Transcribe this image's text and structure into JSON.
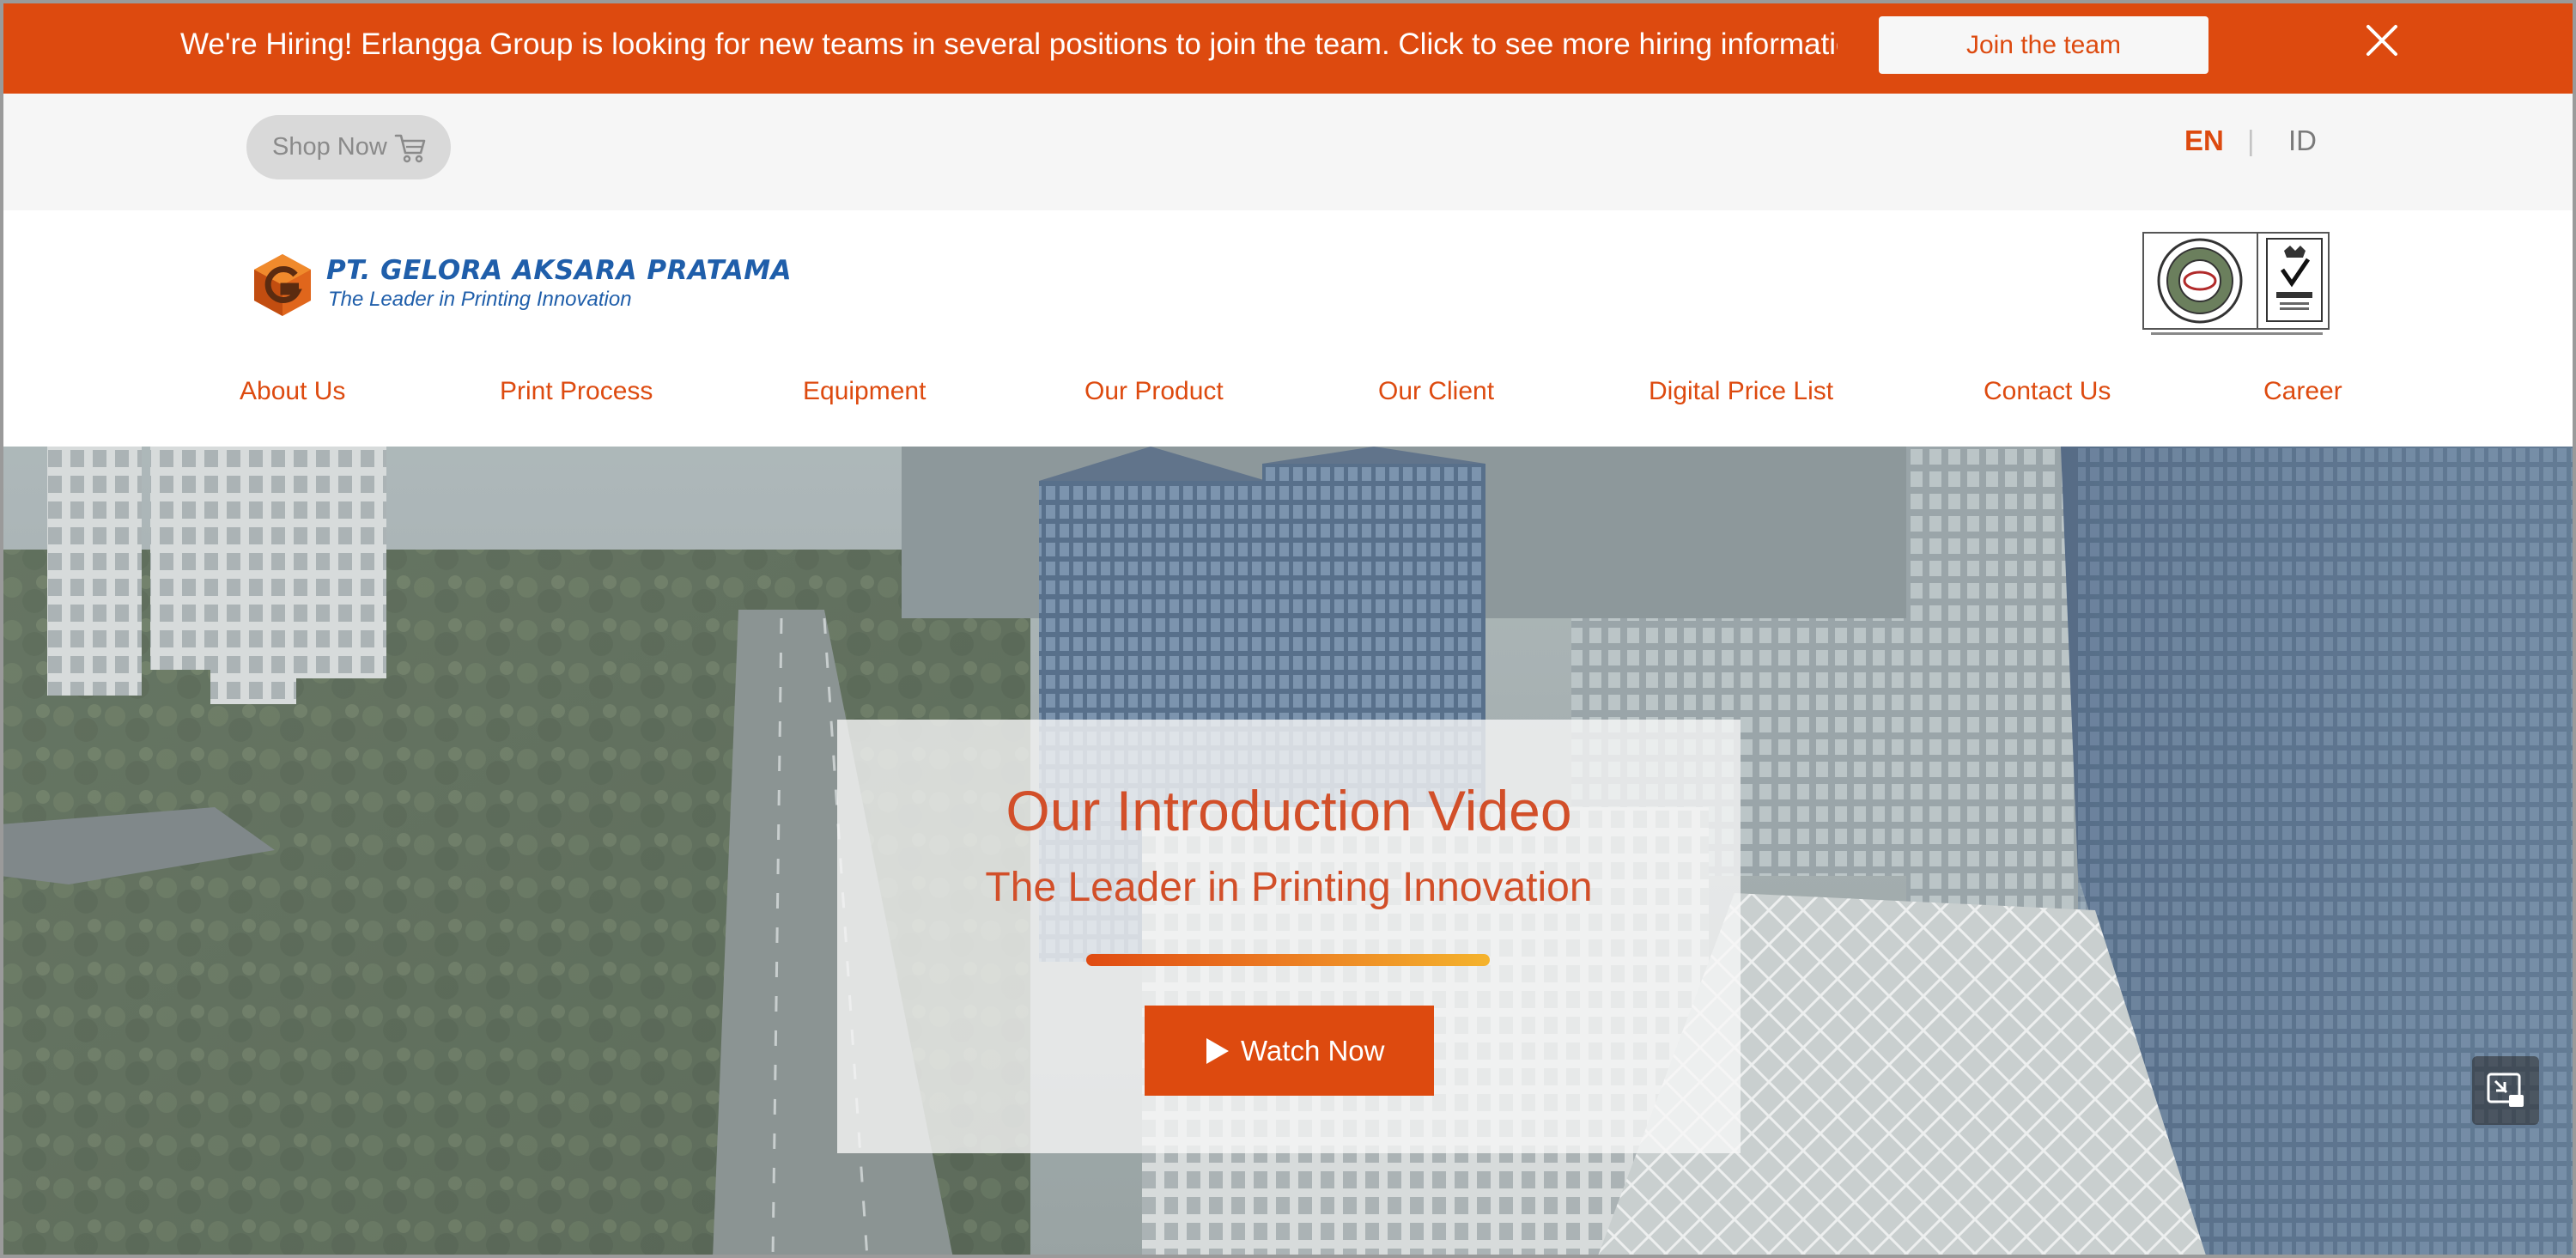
{
  "hiring": {
    "message": "We're Hiring! Erlangga Group is looking for new teams in several positions to join the team. Click to see more hiring information",
    "join_label": "Join the team",
    "close_icon": "close-icon"
  },
  "util": {
    "shop_label": "Shop Now",
    "shop_icon": "cart-icon",
    "lang_en": "EN",
    "lang_separator": "|",
    "lang_id": "ID"
  },
  "header": {
    "company_name": "PT. GELORA AKSARA PRATAMA",
    "tagline": "The Leader in Printing Innovation",
    "cert_icon": "certification-badges-icon"
  },
  "nav": [
    {
      "label": "About Us"
    },
    {
      "label": "Print Process"
    },
    {
      "label": "Equipment"
    },
    {
      "label": "Our Product"
    },
    {
      "label": "Our Client"
    },
    {
      "label": "Digital Price List"
    },
    {
      "label": "Contact Us"
    },
    {
      "label": "Career"
    }
  ],
  "hero": {
    "title": "Our Introduction Video",
    "subtitle": "The Leader in Printing Innovation",
    "watch_label": "Watch Now",
    "play_icon": "play-icon",
    "pip_icon": "picture-in-picture-icon"
  },
  "colors": {
    "brand_orange": "#dd4a0f",
    "brand_blue": "#1f5eaa",
    "util_bg": "#f6f6f6"
  }
}
